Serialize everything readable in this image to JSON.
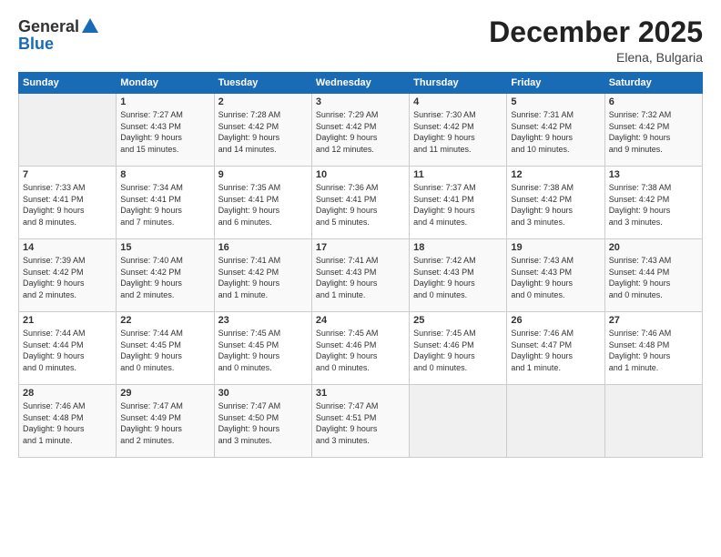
{
  "logo": {
    "general": "General",
    "blue": "Blue"
  },
  "title": "December 2025",
  "location": "Elena, Bulgaria",
  "days_header": [
    "Sunday",
    "Monday",
    "Tuesday",
    "Wednesday",
    "Thursday",
    "Friday",
    "Saturday"
  ],
  "weeks": [
    [
      {
        "num": "",
        "info": ""
      },
      {
        "num": "1",
        "info": "Sunrise: 7:27 AM\nSunset: 4:43 PM\nDaylight: 9 hours\nand 15 minutes."
      },
      {
        "num": "2",
        "info": "Sunrise: 7:28 AM\nSunset: 4:42 PM\nDaylight: 9 hours\nand 14 minutes."
      },
      {
        "num": "3",
        "info": "Sunrise: 7:29 AM\nSunset: 4:42 PM\nDaylight: 9 hours\nand 12 minutes."
      },
      {
        "num": "4",
        "info": "Sunrise: 7:30 AM\nSunset: 4:42 PM\nDaylight: 9 hours\nand 11 minutes."
      },
      {
        "num": "5",
        "info": "Sunrise: 7:31 AM\nSunset: 4:42 PM\nDaylight: 9 hours\nand 10 minutes."
      },
      {
        "num": "6",
        "info": "Sunrise: 7:32 AM\nSunset: 4:42 PM\nDaylight: 9 hours\nand 9 minutes."
      }
    ],
    [
      {
        "num": "7",
        "info": "Sunrise: 7:33 AM\nSunset: 4:41 PM\nDaylight: 9 hours\nand 8 minutes."
      },
      {
        "num": "8",
        "info": "Sunrise: 7:34 AM\nSunset: 4:41 PM\nDaylight: 9 hours\nand 7 minutes."
      },
      {
        "num": "9",
        "info": "Sunrise: 7:35 AM\nSunset: 4:41 PM\nDaylight: 9 hours\nand 6 minutes."
      },
      {
        "num": "10",
        "info": "Sunrise: 7:36 AM\nSunset: 4:41 PM\nDaylight: 9 hours\nand 5 minutes."
      },
      {
        "num": "11",
        "info": "Sunrise: 7:37 AM\nSunset: 4:41 PM\nDaylight: 9 hours\nand 4 minutes."
      },
      {
        "num": "12",
        "info": "Sunrise: 7:38 AM\nSunset: 4:42 PM\nDaylight: 9 hours\nand 3 minutes."
      },
      {
        "num": "13",
        "info": "Sunrise: 7:38 AM\nSunset: 4:42 PM\nDaylight: 9 hours\nand 3 minutes."
      }
    ],
    [
      {
        "num": "14",
        "info": "Sunrise: 7:39 AM\nSunset: 4:42 PM\nDaylight: 9 hours\nand 2 minutes."
      },
      {
        "num": "15",
        "info": "Sunrise: 7:40 AM\nSunset: 4:42 PM\nDaylight: 9 hours\nand 2 minutes."
      },
      {
        "num": "16",
        "info": "Sunrise: 7:41 AM\nSunset: 4:42 PM\nDaylight: 9 hours\nand 1 minute."
      },
      {
        "num": "17",
        "info": "Sunrise: 7:41 AM\nSunset: 4:43 PM\nDaylight: 9 hours\nand 1 minute."
      },
      {
        "num": "18",
        "info": "Sunrise: 7:42 AM\nSunset: 4:43 PM\nDaylight: 9 hours\nand 0 minutes."
      },
      {
        "num": "19",
        "info": "Sunrise: 7:43 AM\nSunset: 4:43 PM\nDaylight: 9 hours\nand 0 minutes."
      },
      {
        "num": "20",
        "info": "Sunrise: 7:43 AM\nSunset: 4:44 PM\nDaylight: 9 hours\nand 0 minutes."
      }
    ],
    [
      {
        "num": "21",
        "info": "Sunrise: 7:44 AM\nSunset: 4:44 PM\nDaylight: 9 hours\nand 0 minutes."
      },
      {
        "num": "22",
        "info": "Sunrise: 7:44 AM\nSunset: 4:45 PM\nDaylight: 9 hours\nand 0 minutes."
      },
      {
        "num": "23",
        "info": "Sunrise: 7:45 AM\nSunset: 4:45 PM\nDaylight: 9 hours\nand 0 minutes."
      },
      {
        "num": "24",
        "info": "Sunrise: 7:45 AM\nSunset: 4:46 PM\nDaylight: 9 hours\nand 0 minutes."
      },
      {
        "num": "25",
        "info": "Sunrise: 7:45 AM\nSunset: 4:46 PM\nDaylight: 9 hours\nand 0 minutes."
      },
      {
        "num": "26",
        "info": "Sunrise: 7:46 AM\nSunset: 4:47 PM\nDaylight: 9 hours\nand 1 minute."
      },
      {
        "num": "27",
        "info": "Sunrise: 7:46 AM\nSunset: 4:48 PM\nDaylight: 9 hours\nand 1 minute."
      }
    ],
    [
      {
        "num": "28",
        "info": "Sunrise: 7:46 AM\nSunset: 4:48 PM\nDaylight: 9 hours\nand 1 minute."
      },
      {
        "num": "29",
        "info": "Sunrise: 7:47 AM\nSunset: 4:49 PM\nDaylight: 9 hours\nand 2 minutes."
      },
      {
        "num": "30",
        "info": "Sunrise: 7:47 AM\nSunset: 4:50 PM\nDaylight: 9 hours\nand 3 minutes."
      },
      {
        "num": "31",
        "info": "Sunrise: 7:47 AM\nSunset: 4:51 PM\nDaylight: 9 hours\nand 3 minutes."
      },
      {
        "num": "",
        "info": ""
      },
      {
        "num": "",
        "info": ""
      },
      {
        "num": "",
        "info": ""
      }
    ]
  ]
}
